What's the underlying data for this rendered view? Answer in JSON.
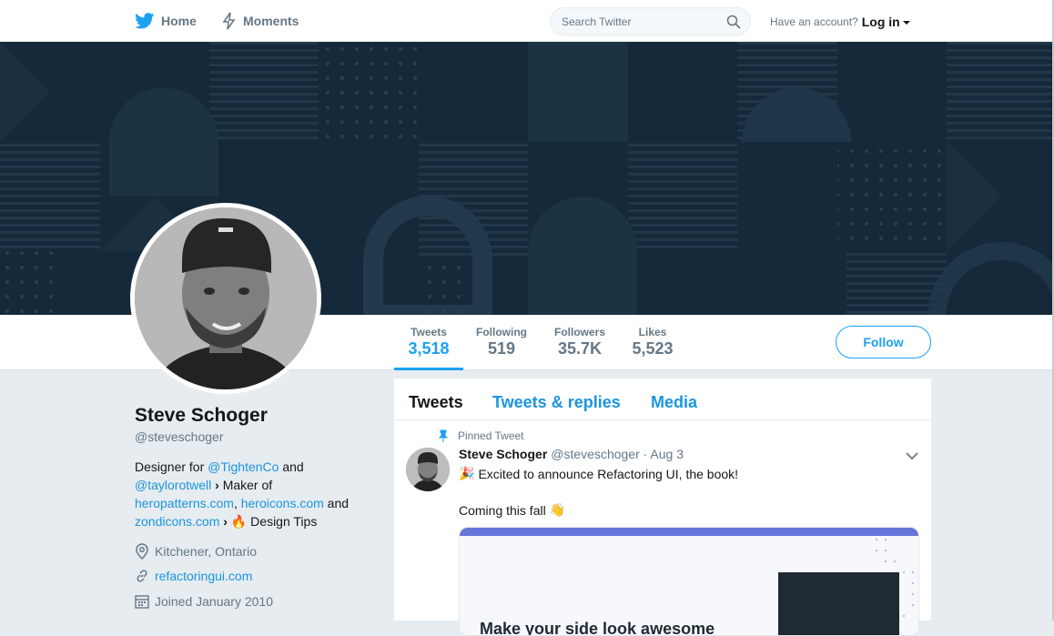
{
  "topbar": {
    "home_label": "Home",
    "moments_label": "Moments",
    "search_placeholder": "Search Twitter",
    "account_prompt": "Have an account?",
    "login_label": "Log in"
  },
  "profile": {
    "name": "Steve Schoger",
    "handle": "@steveschoger",
    "bio": {
      "part1": "Designer for ",
      "link1": "@TightenCo",
      "part2": " and ",
      "link2": "@taylorotwell",
      "part3": " Maker of ",
      "link3": "heropatterns.com",
      "part4": ", ",
      "link4": "heroicons.com",
      "part5": " and ",
      "link5": "zondicons.com",
      "part6": " Design Tips"
    },
    "location": "Kitchener, Ontario",
    "website": "refactoringui.com",
    "joined": "Joined January 2010"
  },
  "stats": [
    {
      "label": "Tweets",
      "value": "3,518"
    },
    {
      "label": "Following",
      "value": "519"
    },
    {
      "label": "Followers",
      "value": "35.7K"
    },
    {
      "label": "Likes",
      "value": "5,523"
    }
  ],
  "follow_label": "Follow",
  "timeline": {
    "tabs": [
      "Tweets",
      "Tweets & replies",
      "Media"
    ],
    "pinned_label": "Pinned Tweet",
    "tweet": {
      "author": "Steve Schoger",
      "handle": "@steveschoger",
      "date": "· Aug 3",
      "line1": "Excited to announce Refactoring UI, the book!",
      "line2": "Coming this fall",
      "card_heading": "Make your side look awesome"
    }
  },
  "colors": {
    "accent": "#1da1f2",
    "banner": "#15293a",
    "card_bar": "#6774d9"
  }
}
